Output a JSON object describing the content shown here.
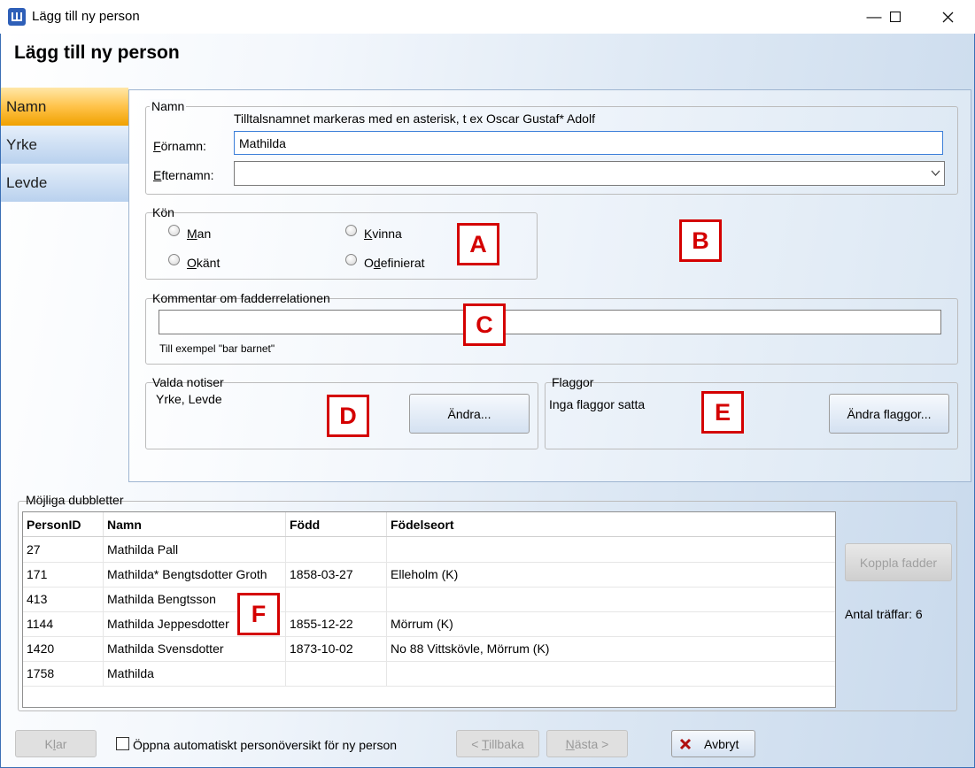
{
  "window": {
    "title": "Lägg till ny person"
  },
  "header": {
    "title": "Lägg till ny person"
  },
  "sidebar": {
    "items": [
      {
        "label": "Namn"
      },
      {
        "label": "Yrke"
      },
      {
        "label": "Levde"
      }
    ]
  },
  "name_group": {
    "legend": "Namn",
    "hint": "Tilltalsnamnet markeras med en asterisk, t ex  Oscar Gustaf* Adolf",
    "first_name_label": "Förnamn:",
    "first_name_value": "Mathilda",
    "last_name_label": "Efternamn:",
    "last_name_value": ""
  },
  "gender_group": {
    "legend": "Kön",
    "options": [
      {
        "label": "Man"
      },
      {
        "label": "Kvinna"
      },
      {
        "label": "Okänt"
      },
      {
        "label": "Odefinierat"
      }
    ]
  },
  "comment_group": {
    "legend": "Kommentar om fadderrelationen",
    "value": "",
    "hint": "Till exempel \"bar barnet\""
  },
  "notes_group": {
    "legend": "Valda notiser",
    "value": "Yrke, Levde",
    "button": "Ändra..."
  },
  "flags_group": {
    "legend": "Flaggor",
    "value": "Inga flaggor satta",
    "button": "Ändra flaggor..."
  },
  "markers": [
    "A",
    "B",
    "C",
    "D",
    "E",
    "F"
  ],
  "duplicates": {
    "legend": "Möjliga dubbletter",
    "columns": [
      "PersonID",
      "Namn",
      "Född",
      "Födelseort"
    ],
    "rows": [
      [
        "27",
        "Mathilda Pall",
        "",
        ""
      ],
      [
        "171",
        "Mathilda* Bengtsdotter Groth",
        "1858-03-27",
        "Elleholm (K)"
      ],
      [
        "413",
        "Mathilda Bengtsson",
        "",
        ""
      ],
      [
        "1144",
        "Mathilda Jeppesdotter",
        "1855-12-22",
        "Mörrum (K)"
      ],
      [
        "1420",
        "Mathilda Svensdotter",
        "1873-10-02",
        "No 88 Vittskövle, Mörrum (K)"
      ],
      [
        "1758",
        "Mathilda",
        "",
        ""
      ]
    ],
    "link_button": "Koppla fadder",
    "hits": "Antal träffar: 6"
  },
  "footer": {
    "done_button": "Klar",
    "auto_open_label": "Öppna automatiskt personöversikt för ny person",
    "back_button": "< Tillbaka",
    "next_button": "Nästa >",
    "cancel_button": "Avbryt"
  },
  "colors": {
    "accent": "#3c7fd9",
    "nav_active": "#ffc34a",
    "marker": "#d40000"
  }
}
